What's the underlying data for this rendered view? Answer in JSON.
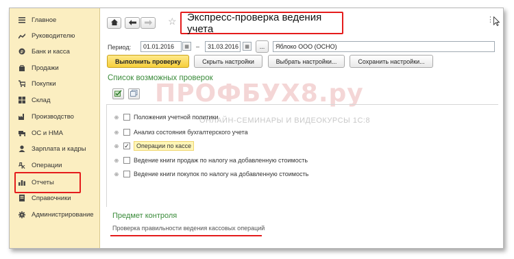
{
  "sidebar": {
    "items": [
      {
        "label": "Главное",
        "icon": "menu-icon"
      },
      {
        "label": "Руководителю",
        "icon": "chart-trend-icon"
      },
      {
        "label": "Банк и касса",
        "icon": "coin-icon"
      },
      {
        "label": "Продажи",
        "icon": "bag-icon"
      },
      {
        "label": "Покупки",
        "icon": "cart-icon"
      },
      {
        "label": "Склад",
        "icon": "warehouse-icon"
      },
      {
        "label": "Производство",
        "icon": "factory-icon"
      },
      {
        "label": "ОС и НМА",
        "icon": "truck-icon"
      },
      {
        "label": "Зарплата и кадры",
        "icon": "person-icon"
      },
      {
        "label": "Операции",
        "icon": "operations-icon"
      },
      {
        "label": "Отчеты",
        "icon": "bar-chart-icon"
      },
      {
        "label": "Справочники",
        "icon": "book-icon"
      },
      {
        "label": "Администрирование",
        "icon": "gear-icon"
      }
    ]
  },
  "header": {
    "title": "Экспресс-проверка ведения учета"
  },
  "period": {
    "label": "Период:",
    "from": "01.01.2016",
    "separator": "–",
    "to": "31.03.2016",
    "ellipsis": "...",
    "organization": "Яблоко ООО (ОСНО)"
  },
  "toolbar": {
    "run_label": "Выполнить проверку",
    "hide_settings_label": "Скрыть настройки",
    "choose_settings_label": "Выбрать настройки...",
    "save_settings_label": "Сохранить настройки..."
  },
  "checks": {
    "title": "Список возможных проверок",
    "items": [
      {
        "label": "Положения учетной политики",
        "checked": false
      },
      {
        "label": "Анализ состояния бухгалтерского учета",
        "checked": false
      },
      {
        "label": "Операции по кассе",
        "checked": true
      },
      {
        "label": "Ведение книги продаж по налогу на добавленную стоимость",
        "checked": false
      },
      {
        "label": "Ведение книги покупок по налогу на добавленную стоимость",
        "checked": false
      }
    ]
  },
  "watermark": {
    "title": "ПРОФБУХ8.ру",
    "subtitle": "ОНЛАЙН-СЕМИНАРЫ И ВИДЕОКУРСЫ 1С:8"
  },
  "subject": {
    "title": "Предмет контроля",
    "text": "Проверка правильности ведения кассовых операций"
  },
  "colors": {
    "sidebar_bg": "#fbeec1",
    "accent_green": "#3a8b3a",
    "highlight_red": "#e41b1b",
    "primary_button": "#f6cf3c"
  }
}
